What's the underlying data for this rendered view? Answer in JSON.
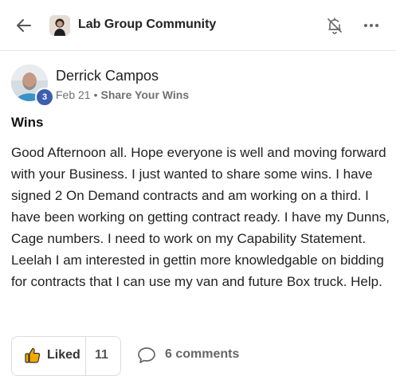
{
  "header": {
    "group_title": "Lab Group Community",
    "back_icon": "arrow-left-icon",
    "notification_icon": "bell-off-icon",
    "more_icon": "more-horizontal-icon"
  },
  "post": {
    "author": {
      "name": "Derrick Campos",
      "level": "3"
    },
    "date": "Feb 21",
    "separator": "•",
    "category": "Share Your Wins",
    "title": "Wins",
    "body": "Good Afternoon all. Hope everyone is well and moving forward with your Business. I just wanted to share some wins. I have signed 2 On Demand contracts and am working on a third. I have been working on getting contract ready. I have my Dunns, Cage numbers. I need to work on my Capability Statement. Leelah I am interested in gettin more knowledgable on bidding for contracts that I can use my van and future Box truck. Help."
  },
  "actions": {
    "like_label": "Liked",
    "like_count": "11",
    "comments_label": "6 comments",
    "like_icon": "thumbs-up-icon",
    "comment_icon": "chat-bubble-icon"
  },
  "colors": {
    "accent": "#3d5db0",
    "like_fill": "#f2a900"
  }
}
